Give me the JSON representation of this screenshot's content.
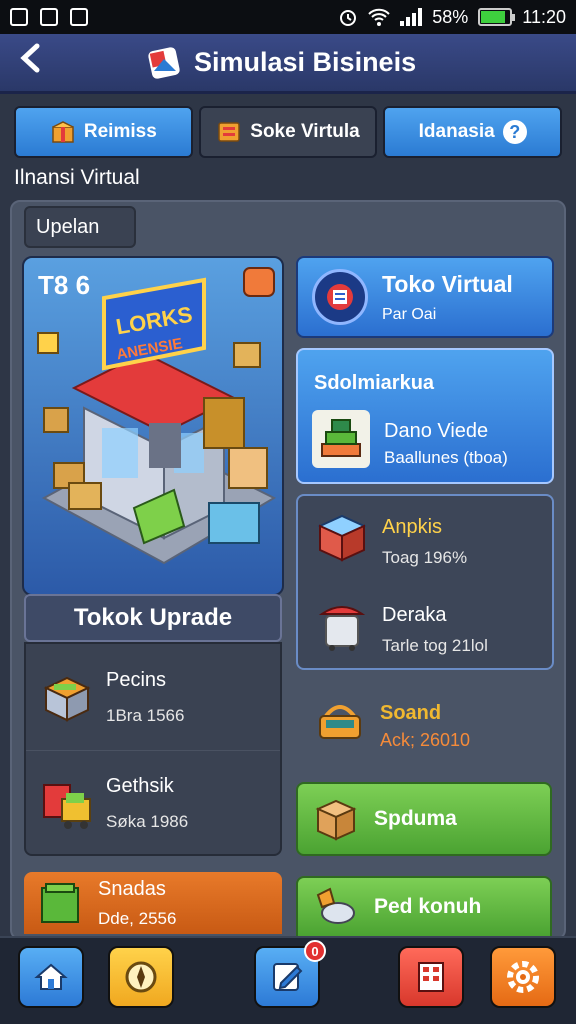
{
  "status_bar": {
    "battery": "58%",
    "time": "11:20"
  },
  "app_bar": {
    "title": "Simulasi Bisineis"
  },
  "tabs": [
    {
      "label": "Reimiss"
    },
    {
      "label": "Soke Virtula"
    },
    {
      "label": "Idanasia"
    }
  ],
  "section_label": "Ilnansi Virtual",
  "upgrade_chip": "Upelan",
  "store_card": {
    "level": "T8 6",
    "sign_line1": "LORKS",
    "sign_line2": "ANENSIE"
  },
  "tokok": {
    "header": "Tokok Uprade",
    "items": [
      {
        "name": "Pecins",
        "sub": "1Bra 1566"
      },
      {
        "name": "Gethsik",
        "sub": "Søka 1986"
      }
    ]
  },
  "orange_card": {
    "name": "Snadas",
    "sub": "Dde, 2556"
  },
  "toko_virtual": {
    "title": "Toko Virtual",
    "sub": "Par Oai"
  },
  "sdm_card": {
    "title": "Sdolmiarkua",
    "name": "Dano Viede",
    "sub": "Baallunes (tboa)"
  },
  "stats": [
    {
      "name": "Anpkis",
      "sub": "Toag 196%"
    },
    {
      "name": "Deraka",
      "sub": "Tarle tog 21lol"
    }
  ],
  "sound": {
    "name": "Soand",
    "sub": "Ack; 26010"
  },
  "green_buttons": [
    {
      "label": "Spduma"
    },
    {
      "label": "Ped konuh"
    }
  ],
  "bottom_nav": {
    "task_badge": "0"
  }
}
